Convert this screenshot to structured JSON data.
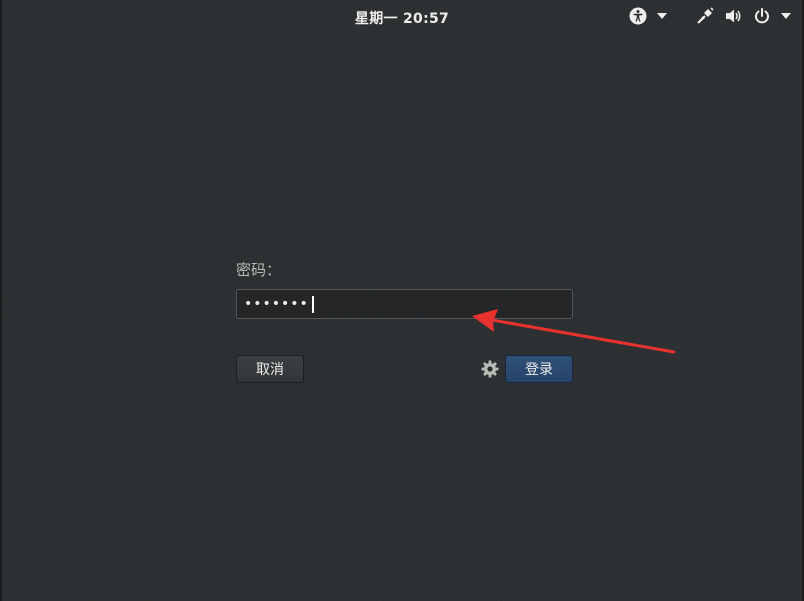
{
  "topbar": {
    "clock": "星期一 20:57",
    "icons": [
      "accessibility-icon",
      "chevron-down-icon",
      "network-icon",
      "volume-icon",
      "power-icon",
      "chevron-down-icon"
    ]
  },
  "login": {
    "password_label": "密码：",
    "password_masked": "•••••••",
    "cancel_label": "取消",
    "login_label": "登录",
    "settings_icon": "gear-icon"
  },
  "annotation": {
    "arrow_color": "#e8322f"
  },
  "colors": {
    "background": "#2d3032",
    "login_button": "#2a4a72",
    "text": "#eeeeec"
  }
}
